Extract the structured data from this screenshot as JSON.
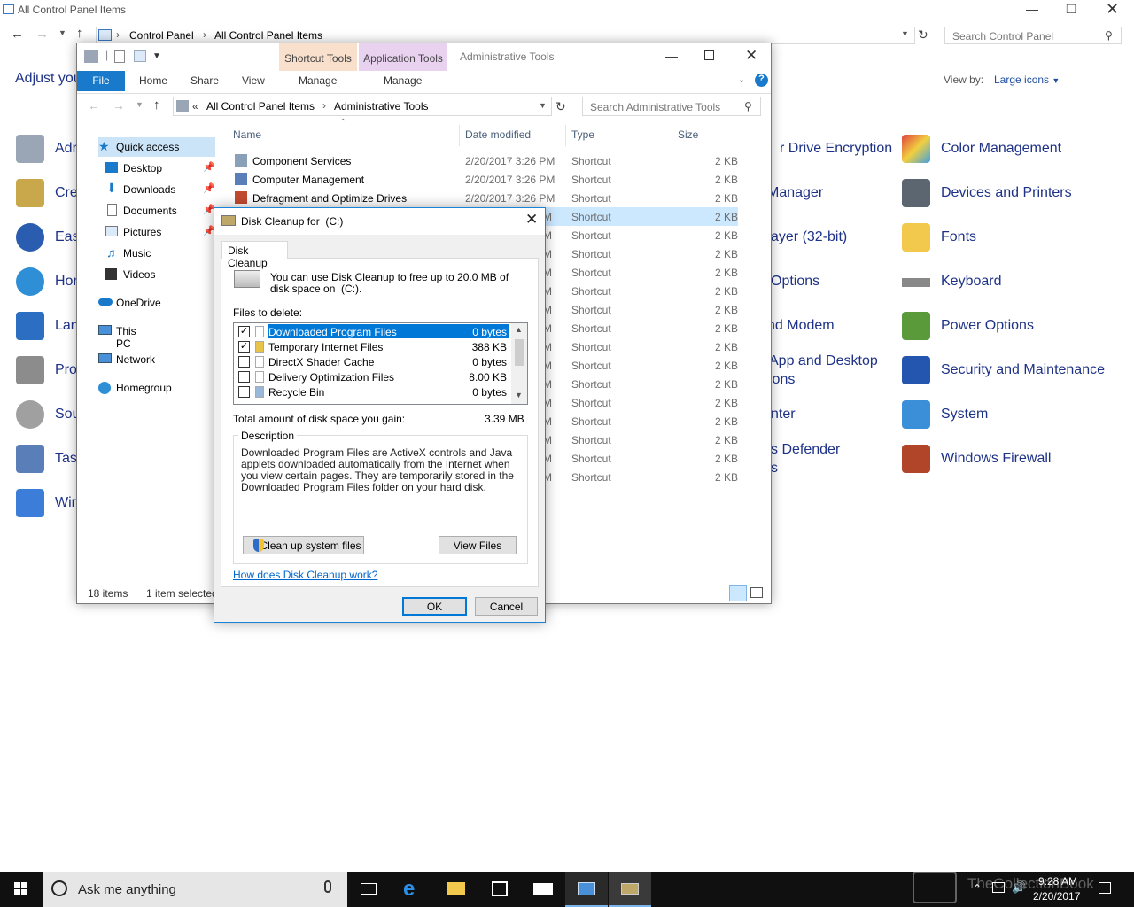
{
  "cp": {
    "title": "All Control Panel Items",
    "breadcrumb": [
      "Control Panel",
      "All Control Panel Items"
    ],
    "search_placeholder": "Search Control Panel",
    "adjust_text": "Adjust your",
    "view_by_label": "View by:",
    "view_by_value": "Large icons",
    "left_items": [
      "Adr",
      "Cre",
      "Eas",
      "Hor",
      "Lan",
      "Pro",
      "Sou",
      "Task",
      "Wir"
    ],
    "mid_items": [
      "r Drive Encryption",
      "Manager",
      "ayer (32-bit)",
      "Options",
      "nd Modem",
      "App and Desktop",
      "ions",
      "nter",
      "s Defender",
      "s"
    ],
    "right_items": [
      "Color Management",
      "Devices and Printers",
      "Fonts",
      "Keyboard",
      "Power Options",
      "Security and Maintenance",
      "System",
      "Windows Firewall"
    ]
  },
  "explorer": {
    "title": "Administrative Tools",
    "context_tabs": [
      "Shortcut Tools",
      "Application Tools"
    ],
    "ribbon_tabs": [
      "File",
      "Home",
      "Share",
      "View",
      "Manage",
      "Manage"
    ],
    "address": [
      "All Control Panel Items",
      "Administrative Tools"
    ],
    "address_prefix": "«",
    "search_placeholder": "Search Administrative Tools",
    "nav": [
      "Quick access",
      "Desktop",
      "Downloads",
      "Documents",
      "Pictures",
      "Music",
      "Videos",
      "OneDrive",
      "This PC",
      "Network",
      "Homegroup"
    ],
    "columns": [
      "Name",
      "Date modified",
      "Type",
      "Size"
    ],
    "rows": [
      {
        "name": "Component Services",
        "date": "2/20/2017 3:26 PM",
        "type": "Shortcut",
        "size": "2 KB"
      },
      {
        "name": "Computer Management",
        "date": "2/20/2017 3:26 PM",
        "type": "Shortcut",
        "size": "2 KB"
      },
      {
        "name": "Defragment and Optimize Drives",
        "date": "2/20/2017 3:26 PM",
        "type": "Shortcut",
        "size": "2 KB"
      }
    ],
    "hidden_row_type": "Shortcut",
    "hidden_row_size": "2 KB",
    "hidden_row_partial_date": "M",
    "status_items": "18 items",
    "status_selected": "1 item selected"
  },
  "dialog": {
    "title": "Disk Cleanup for  (C:)",
    "tab": "Disk Cleanup",
    "intro": "You can use Disk Cleanup to free up to 20.0 MB of disk space on  (C:).",
    "files_label": "Files to delete:",
    "files": [
      {
        "name": "Downloaded Program Files",
        "size": "0 bytes",
        "checked": true,
        "selected": true
      },
      {
        "name": "Temporary Internet Files",
        "size": "388 KB",
        "checked": true,
        "selected": false
      },
      {
        "name": "DirectX Shader Cache",
        "size": "0 bytes",
        "checked": false,
        "selected": false
      },
      {
        "name": "Delivery Optimization Files",
        "size": "8.00 KB",
        "checked": false,
        "selected": false
      },
      {
        "name": "Recycle Bin",
        "size": "0 bytes",
        "checked": false,
        "selected": false
      }
    ],
    "total_label": "Total amount of disk space you gain:",
    "total_value": "3.39 MB",
    "desc_label": "Description",
    "desc_text": "Downloaded Program Files are ActiveX controls and Java applets downloaded automatically from the Internet when you view certain pages. They are temporarily stored in the Downloaded Program Files folder on your hard disk.",
    "cleanup_system_btn": "Clean up system files",
    "view_files_btn": "View Files",
    "help_link": "How does Disk Cleanup work?",
    "ok_btn": "OK",
    "cancel_btn": "Cancel"
  },
  "taskbar": {
    "search_placeholder": "Ask me anything",
    "time": "9:28 AM",
    "date": "2/20/2017",
    "watermark": "TheCollectionBook"
  }
}
